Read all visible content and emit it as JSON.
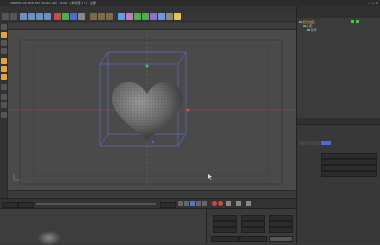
{
  "window": {
    "title": "CINEMA 4D R18.057 Studio (RC - R18) - [未标题 1 *] - 主要"
  },
  "menus": [
    "文件",
    "编辑",
    "创建",
    "选择",
    "工具",
    "网格",
    "捕捉",
    "动画",
    "模拟",
    "渲染",
    "雕刻",
    "运动跟踪",
    "运动图形",
    "角色",
    "流水线",
    "插件",
    "脚本",
    "窗口",
    "帮助"
  ],
  "viewport": {
    "menu": [
      "查看",
      "摄像机",
      "显示",
      "选项",
      "过滤",
      "面板"
    ],
    "label": "透视视图"
  },
  "timeline": {
    "ticks": [
      "0",
      "5",
      "10",
      "15",
      "20",
      "25",
      "30",
      "35",
      "40",
      "45",
      "50",
      "55",
      "60",
      "65",
      "70",
      "75",
      "80",
      "85",
      "90"
    ],
    "end_label": "0 F"
  },
  "transport": {
    "start": "0 F",
    "current": "0 F",
    "end": "90 F",
    "end2": "90 F"
  },
  "materials": {
    "menu": [
      "创建",
      "编辑",
      "功能",
      "纹理"
    ]
  },
  "coords": {
    "headers": [
      "位置",
      "尺寸",
      "旋转"
    ],
    "rows": [
      {
        "axis": "X",
        "pos": "0 cm",
        "size": "0 cm",
        "rot_axis": "H",
        "rot": "0 °"
      },
      {
        "axis": "Y",
        "pos": "0 cm",
        "size": "0 cm",
        "rot_axis": "P",
        "rot": "0 °"
      },
      {
        "axis": "Z",
        "pos": "0 cm",
        "size": "0 cm",
        "rot_axis": "B",
        "rot": "0 °"
      }
    ],
    "mode": "对象 (相对)",
    "size_mode": "绝对尺寸",
    "apply": "应用"
  },
  "objects": {
    "menu": [
      "文件",
      "编辑",
      "查看",
      "对象",
      "标签",
      "书签"
    ],
    "tree": [
      "细分曲面",
      "心形",
      "对称"
    ]
  },
  "attributes": {
    "menu": [
      "模式",
      "编辑",
      "用户数据"
    ],
    "title": "细分曲面对象 [细分曲面]",
    "tabs": [
      "基本",
      "坐标",
      "对象"
    ],
    "section": "对象属性",
    "fields": [
      {
        "label": "类型",
        "value": "Catmull-Clark (N-Gons)"
      },
      {
        "label": "编辑器细分",
        "value": "2"
      },
      {
        "label": "渲染器细分",
        "value": "3"
      },
      {
        "label": "细分UV",
        "value": "标准"
      }
    ]
  },
  "colors": {
    "accent": "#e8a23a",
    "selection": "#6e6ef0",
    "axis_x": "#d84a4a",
    "axis_y": "#4ac44a",
    "axis_z": "#4a6ad8"
  }
}
